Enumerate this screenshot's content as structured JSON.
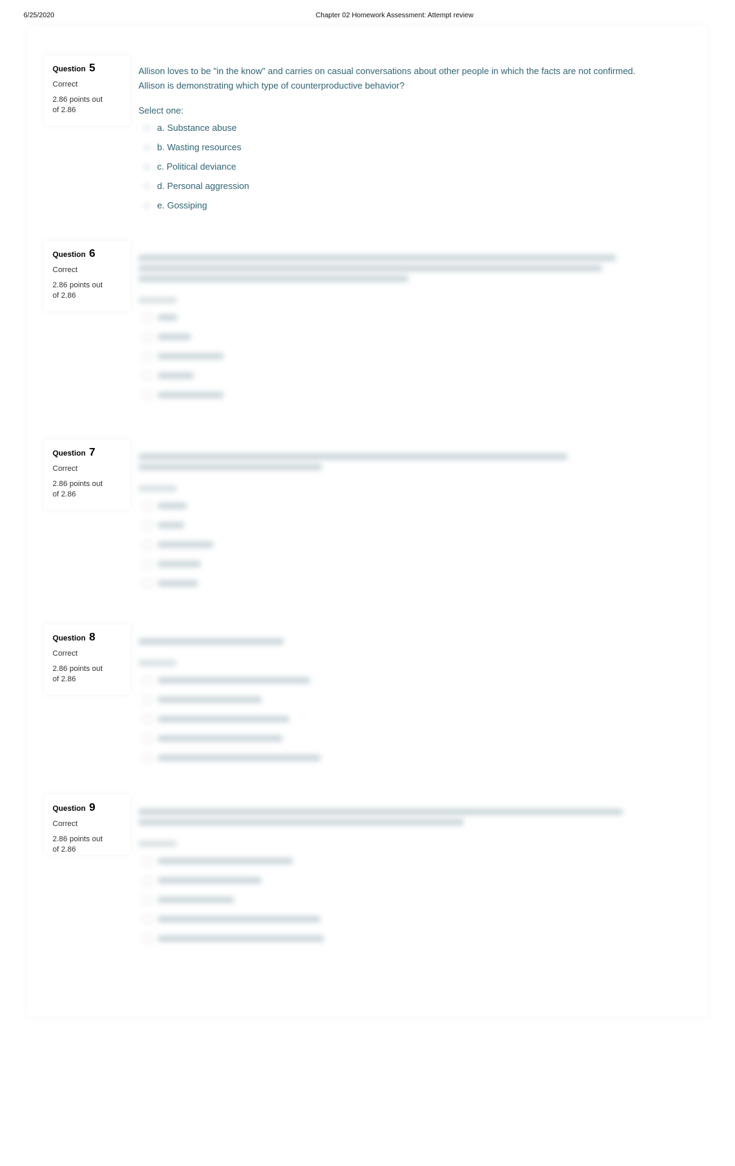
{
  "print_header": {
    "date": "6/25/2020",
    "title": "Chapter 02 Homework Assessment: Attempt review"
  },
  "questions": [
    {
      "label": "Question",
      "number": "5",
      "state": "Correct",
      "grade": "2.86 points out of 2.86",
      "text": "Allison loves to be \"in the know\" and carries on casual conversations about other people in which the facts are not confirmed. Allison is demonstrating which type of counterproductive behavior?",
      "prompt": "Select one:",
      "answers": [
        {
          "label": "a. Substance abuse"
        },
        {
          "label": "b. Wasting resources"
        },
        {
          "label": "c. Political deviance"
        },
        {
          "label": "d. Personal aggression"
        },
        {
          "label": "e. Gossiping"
        }
      ],
      "blurred": false
    },
    {
      "label": "Question",
      "number": "6",
      "state": "Correct",
      "grade": "2.86 points out of 2.86",
      "blurred": true
    },
    {
      "label": "Question",
      "number": "7",
      "state": "Correct",
      "grade": "2.86 points out of 2.86",
      "blurred": true
    },
    {
      "label": "Question",
      "number": "8",
      "state": "Correct",
      "grade": "2.86 points out of 2.86",
      "blurred": true
    },
    {
      "label": "Question",
      "number": "9",
      "state": "Correct",
      "grade": "2.86 points out of 2.86",
      "blurred": true
    }
  ],
  "colors": {
    "question_text": "#2f6473"
  }
}
